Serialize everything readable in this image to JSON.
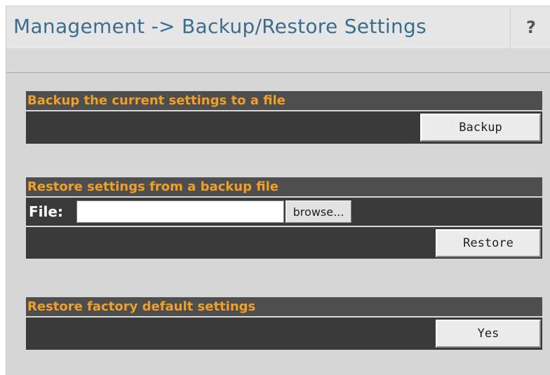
{
  "header": {
    "title": "Management -> Backup/Restore Settings",
    "help_label": "?"
  },
  "backup": {
    "heading": "Backup the current settings to a file",
    "button_label": "Backup"
  },
  "restore": {
    "heading": "Restore settings from a backup file",
    "file_label": "File:",
    "file_value": "",
    "browse_label": "browse...",
    "button_label": "Restore"
  },
  "factory": {
    "heading": "Restore factory default settings",
    "button_label": "Yes"
  },
  "colors": {
    "title": "#3d6d8e",
    "section_heading": "#f0a028",
    "section_bar": "#4e4e4e",
    "section_body": "#3a3a3a"
  }
}
